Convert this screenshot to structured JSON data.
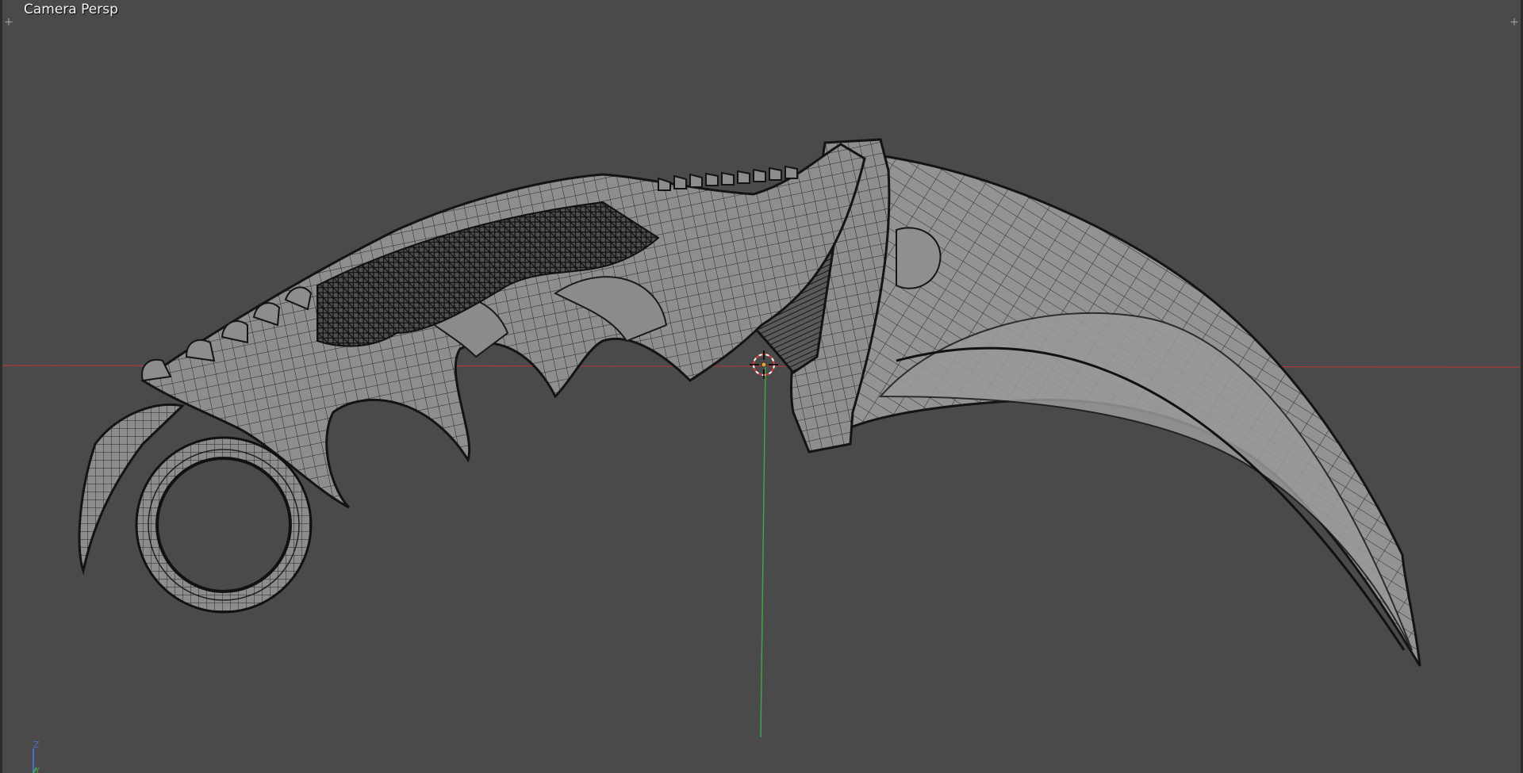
{
  "viewport": {
    "label": "Camera Persp",
    "background": "#4a4a4a"
  },
  "mesh": {
    "name": "karambit-knife",
    "fill": "#8a8a8a",
    "wire": "#1e1e1e"
  },
  "axes": {
    "x_color": "#a83a3a",
    "y_color": "#3fa84a",
    "z_color": "#4a6cd4"
  },
  "gizmo": {
    "z_label": "Z",
    "y_label": "Y"
  },
  "icons": {
    "left_corner": "plus-icon",
    "right_corner": "plus-icon",
    "cursor": "3d-cursor-icon"
  }
}
